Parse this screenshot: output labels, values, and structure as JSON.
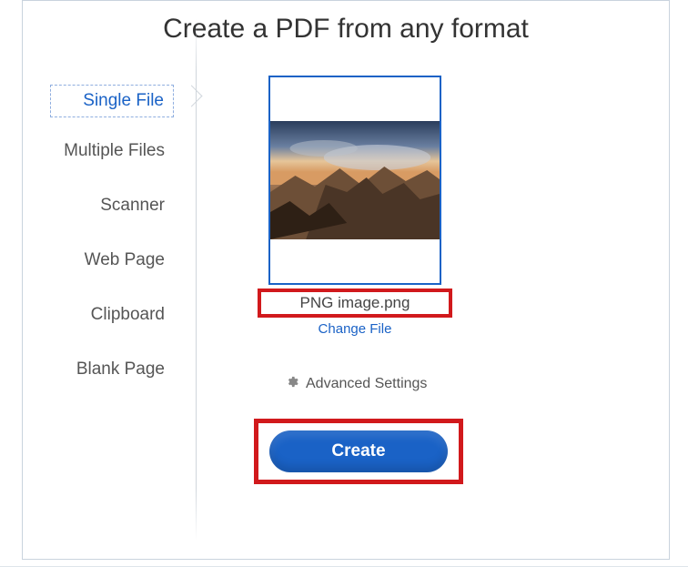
{
  "title": "Create a PDF from any format",
  "sidebar": {
    "items": [
      {
        "label": "Single File"
      },
      {
        "label": "Multiple Files"
      },
      {
        "label": "Scanner"
      },
      {
        "label": "Web Page"
      },
      {
        "label": "Clipboard"
      },
      {
        "label": "Blank Page"
      }
    ]
  },
  "main": {
    "filename": "PNG image.png",
    "change_file": "Change File",
    "advanced": "Advanced Settings",
    "create": "Create"
  },
  "colors": {
    "accent": "#1a62c6",
    "highlight": "#d1191c"
  }
}
